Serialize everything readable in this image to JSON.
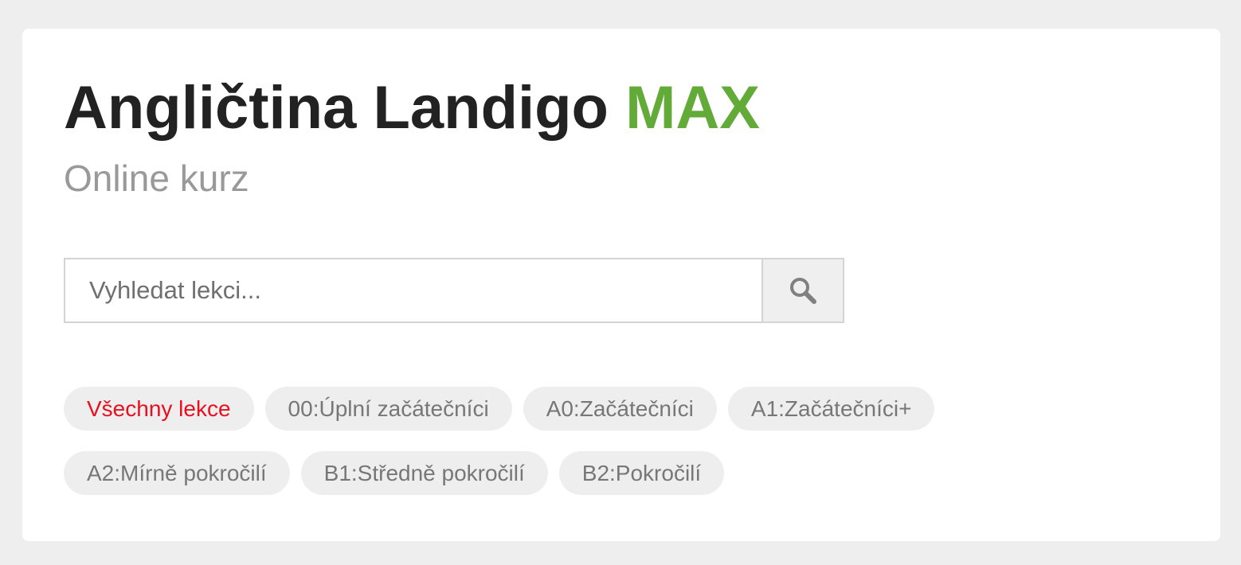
{
  "header": {
    "title": "Angličtina Landigo",
    "title_accent": "MAX",
    "subtitle": "Online kurz"
  },
  "search": {
    "placeholder": "Vyhledat lekci...",
    "button_icon": "search-icon"
  },
  "filters": [
    {
      "label": "Všechny lekce",
      "active": true
    },
    {
      "label": "00:Úplní začátečníci",
      "active": false
    },
    {
      "label": "A0:Začátečníci",
      "active": false
    },
    {
      "label": "A1:Začátečníci+",
      "active": false
    },
    {
      "label": "A2:Mírně pokročilí",
      "active": false
    },
    {
      "label": "B1:Středně pokročilí",
      "active": false
    },
    {
      "label": "B2:Pokročilí",
      "active": false
    }
  ],
  "colors": {
    "accent": "#62ab38",
    "active_filter": "#e8101f",
    "background": "#eeeeee"
  }
}
